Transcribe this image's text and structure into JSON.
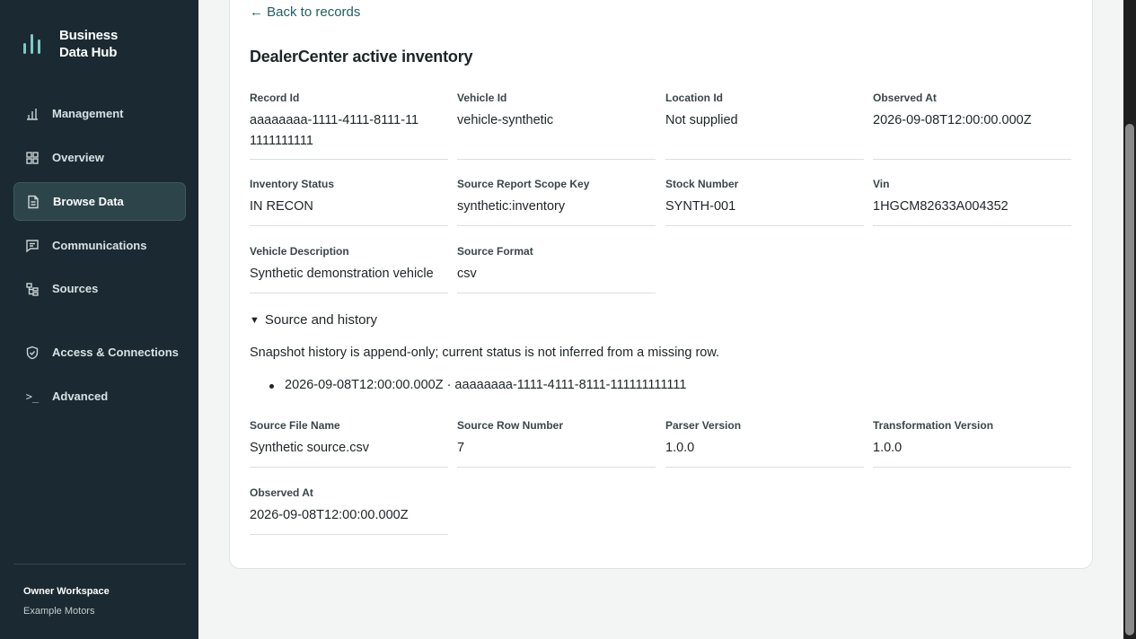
{
  "sidebar": {
    "brand": {
      "line1": "Business",
      "line2": "Data Hub"
    },
    "items": [
      {
        "label": "Management",
        "icon": "bar-chart-icon",
        "active": false
      },
      {
        "label": "Overview",
        "icon": "grid-icon",
        "active": false
      },
      {
        "label": "Browse Data",
        "icon": "document-icon",
        "active": true
      },
      {
        "label": "Communications",
        "icon": "message-icon",
        "active": false
      },
      {
        "label": "Sources",
        "icon": "sources-icon",
        "active": false
      },
      {
        "label": "Access & Connections",
        "icon": "shield-icon",
        "active": false
      },
      {
        "label": "Advanced",
        "icon": "terminal-icon",
        "active": false
      }
    ],
    "workspace": {
      "title": "Owner Workspace",
      "name": "Example Motors"
    }
  },
  "main": {
    "back_link": "← Back to records",
    "title": "DealerCenter active inventory",
    "fields": [
      {
        "label": "Record Id",
        "value": "aaaaaaaa-1111-4111-8111-111111111111"
      },
      {
        "label": "Vehicle Id",
        "value": "vehicle-synthetic"
      },
      {
        "label": "Location Id",
        "value": "Not supplied"
      },
      {
        "label": "Observed At",
        "value": "2026-09-08T12:00:00.000Z"
      },
      {
        "label": "Inventory Status",
        "value": "IN RECON"
      },
      {
        "label": "Source Report Scope Key",
        "value": "synthetic:inventory"
      },
      {
        "label": "Stock Number",
        "value": "SYNTH-001"
      },
      {
        "label": "Vin",
        "value": "1HGCM82633A004352"
      },
      {
        "label": "Vehicle Description",
        "value": "Synthetic demonstration vehicle"
      },
      {
        "label": "Source Format",
        "value": "csv"
      }
    ],
    "source_history": {
      "summary": "Source and history",
      "note": "Snapshot history is append-only; current status is not inferred from a missing row.",
      "entries": [
        "2026-09-08T12:00:00.000Z · aaaaaaaa-1111-4111-8111-111111111111"
      ],
      "fields": [
        {
          "label": "Source File Name",
          "value": "Synthetic source.csv"
        },
        {
          "label": "Source Row Number",
          "value": "7"
        },
        {
          "label": "Parser Version",
          "value": "1.0.0"
        },
        {
          "label": "Transformation Version",
          "value": "1.0.0"
        },
        {
          "label": "Observed At",
          "value": "2026-09-08T12:00:00.000Z"
        }
      ]
    }
  }
}
